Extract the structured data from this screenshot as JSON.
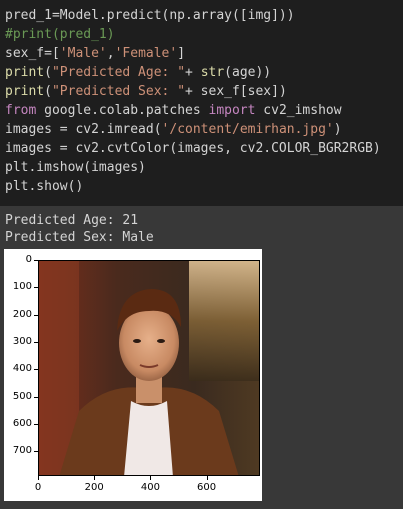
{
  "code_cell": {
    "lines": [
      [
        {
          "t": "pred_1=Model.predict(np.array([img]))",
          "c": ""
        }
      ],
      [
        {
          "t": "#print(pred_1)",
          "c": "tok-com"
        }
      ],
      [
        {
          "t": "sex_f=[",
          "c": ""
        },
        {
          "t": "'Male'",
          "c": "tok-str"
        },
        {
          "t": ",",
          "c": ""
        },
        {
          "t": "'Female'",
          "c": "tok-str"
        },
        {
          "t": "]",
          "c": ""
        }
      ],
      [
        {
          "t": "print",
          "c": "tok-fn"
        },
        {
          "t": "(",
          "c": ""
        },
        {
          "t": "\"Predicted Age: \"",
          "c": "tok-str"
        },
        {
          "t": "+ ",
          "c": ""
        },
        {
          "t": "str",
          "c": "tok-fn"
        },
        {
          "t": "(age))",
          "c": ""
        }
      ],
      [
        {
          "t": "print",
          "c": "tok-fn"
        },
        {
          "t": "(",
          "c": ""
        },
        {
          "t": "\"Predicted Sex: \"",
          "c": "tok-str"
        },
        {
          "t": "+ sex_f[sex])",
          "c": ""
        }
      ],
      [
        {
          "t": "from",
          "c": "tok-kw"
        },
        {
          "t": " google.colab.patches ",
          "c": ""
        },
        {
          "t": "import",
          "c": "tok-kw"
        },
        {
          "t": " cv2_imshow",
          "c": ""
        }
      ],
      [
        {
          "t": "images = cv2.imread(",
          "c": ""
        },
        {
          "t": "'/content/emirhan.jpg'",
          "c": "tok-str"
        },
        {
          "t": ")",
          "c": ""
        }
      ],
      [
        {
          "t": "images = cv2.cvtColor(images, cv2.COLOR_BGR2RGB)",
          "c": ""
        }
      ],
      [
        {
          "t": "plt.imshow(images)",
          "c": ""
        }
      ],
      [
        {
          "t": "plt.show()",
          "c": ""
        }
      ]
    ]
  },
  "output": {
    "age_line": "Predicted Age: 21",
    "sex_line": "Predicted Sex: Male"
  },
  "plot": {
    "y_ticks": [
      "0",
      "100",
      "200",
      "300",
      "400",
      "500",
      "600",
      "700"
    ],
    "x_ticks": [
      "0",
      "200",
      "400",
      "600"
    ]
  },
  "colors": {
    "background": "#383838",
    "code_bg": "#1e1e1e",
    "string": "#ce9178",
    "keyword": "#c586c0",
    "function": "#dcdcaa",
    "comment": "#6a9955"
  }
}
